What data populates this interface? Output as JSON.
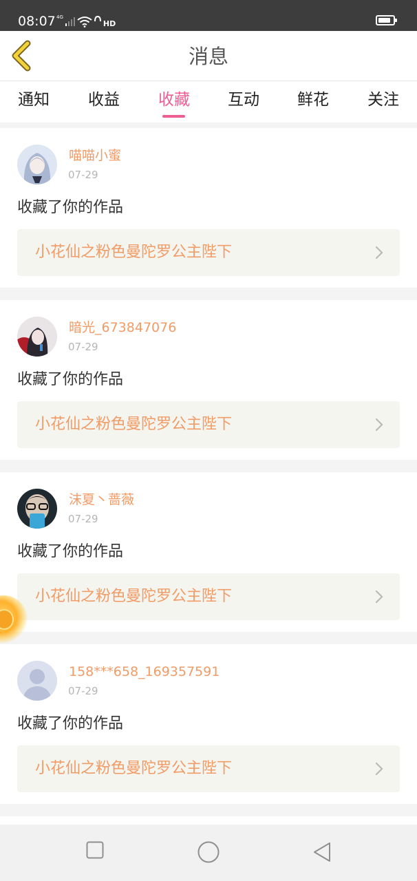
{
  "status_bar": {
    "time": "08:07",
    "network": "4G",
    "hd": "HD",
    "battery_level": 0.85
  },
  "header": {
    "title": "消息",
    "back_icon": "chevron-left-icon"
  },
  "tabs": [
    {
      "label": "通知",
      "active": false
    },
    {
      "label": "收益",
      "active": false
    },
    {
      "label": "收藏",
      "active": true
    },
    {
      "label": "互动",
      "active": false
    },
    {
      "label": "鲜花",
      "active": false
    },
    {
      "label": "关注",
      "active": false
    }
  ],
  "messages": [
    {
      "username": "喵喵小蜜",
      "date": "07-29",
      "action": "收藏了你的作品",
      "work_title": "小花仙之粉色曼陀罗公主陛下"
    },
    {
      "username": "暗光_673847076",
      "date": "07-29",
      "action": "收藏了你的作品",
      "work_title": "小花仙之粉色曼陀罗公主陛下"
    },
    {
      "username": "沫夏丶蔷薇",
      "date": "07-29",
      "action": "收藏了你的作品",
      "work_title": "小花仙之粉色曼陀罗公主陛下"
    },
    {
      "username": "158***658_169357591",
      "date": "07-29",
      "action": "收藏了你的作品",
      "work_title": "小花仙之粉色曼陀罗公主陛下"
    }
  ],
  "colors": {
    "accent_pink": "#ef5d95",
    "name_orange": "#f19b67",
    "back_yellow": "#f2d33a",
    "status_bar": "#3d3d3d"
  },
  "nav": {
    "icons": [
      "square-icon",
      "circle-icon",
      "triangle-back-icon"
    ]
  }
}
